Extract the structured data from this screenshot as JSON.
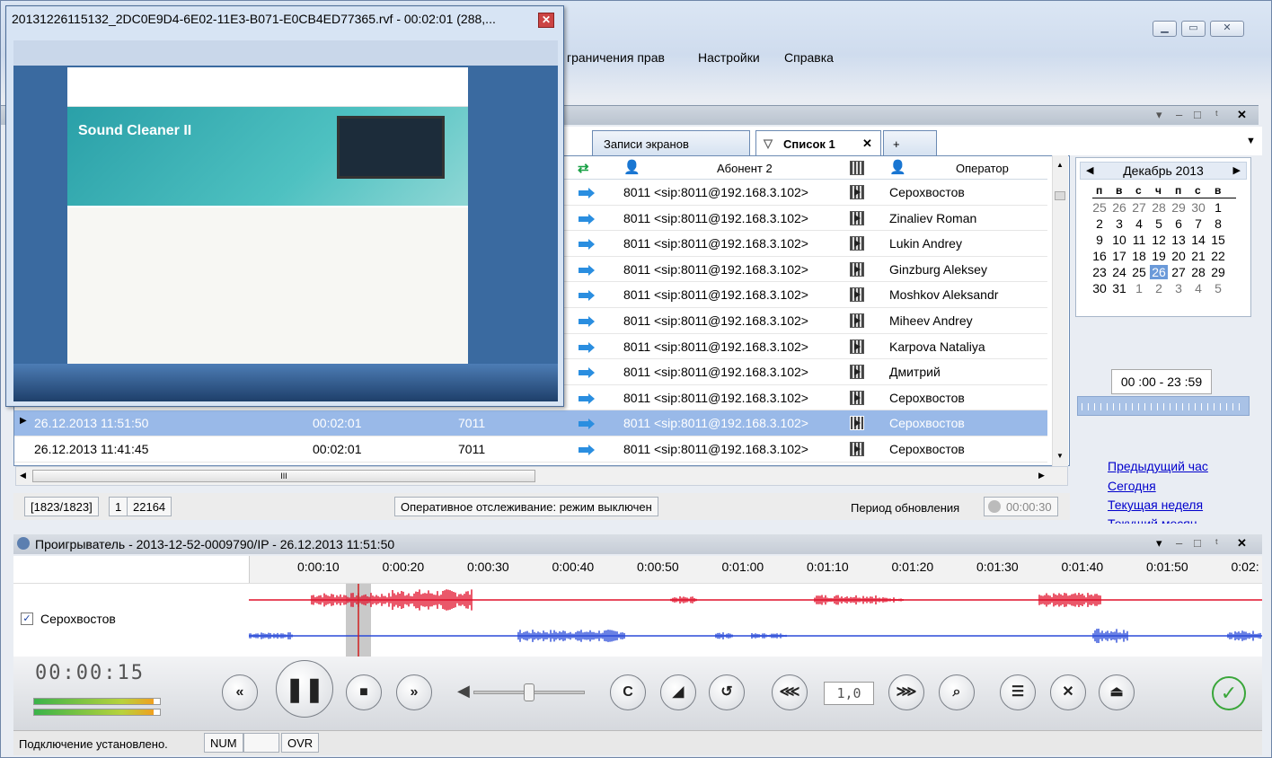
{
  "main_window": {
    "menu": [
      "граничения прав",
      "Настройки",
      "Справка"
    ],
    "dock_controls": [
      "▾",
      "–",
      "□",
      "ᵗ",
      "✕"
    ]
  },
  "tabs": [
    {
      "label": "Записи экранов",
      "active": false
    },
    {
      "label": "Список 1",
      "active": true
    },
    {
      "label": "+",
      "active": false
    }
  ],
  "grid": {
    "columns": [
      "Абонент 2",
      "Оператор"
    ],
    "rows": [
      {
        "datetime": "",
        "duration": "",
        "number": "",
        "abonent2": "8011 <sip:8011@192.168.3.102>",
        "operator": "Серохвостов",
        "selected": false
      },
      {
        "datetime": "",
        "duration": "",
        "number": "",
        "abonent2": "8011 <sip:8011@192.168.3.102>",
        "operator": "Zinaliev Roman",
        "selected": false
      },
      {
        "datetime": "",
        "duration": "",
        "number": "",
        "abonent2": "8011 <sip:8011@192.168.3.102>",
        "operator": "Lukin Andrey",
        "selected": false
      },
      {
        "datetime": "",
        "duration": "",
        "number": "",
        "abonent2": "8011 <sip:8011@192.168.3.102>",
        "operator": "Ginzburg Aleksey",
        "selected": false
      },
      {
        "datetime": "",
        "duration": "",
        "number": "",
        "abonent2": "8011 <sip:8011@192.168.3.102>",
        "operator": "Moshkov Aleksandr",
        "selected": false
      },
      {
        "datetime": "",
        "duration": "",
        "number": "",
        "abonent2": "8011 <sip:8011@192.168.3.102>",
        "operator": "Miheev Andrey",
        "selected": false
      },
      {
        "datetime": "",
        "duration": "",
        "number": "",
        "abonent2": "8011 <sip:8011@192.168.3.102>",
        "operator": "Karpova Nataliya",
        "selected": false
      },
      {
        "datetime": "",
        "duration": "",
        "number": "",
        "abonent2": "8011 <sip:8011@192.168.3.102>",
        "operator": "Дмитрий",
        "selected": false
      },
      {
        "datetime": "",
        "duration": "",
        "number": "",
        "abonent2": "8011 <sip:8011@192.168.3.102>",
        "operator": "Серохвостов",
        "selected": false
      },
      {
        "datetime": "26.12.2013 11:51:50",
        "duration": "00:02:01",
        "number": "7011",
        "abonent2": "8011 <sip:8011@192.168.3.102>",
        "operator": "Серохвостов",
        "selected": true
      },
      {
        "datetime": "26.12.2013 11:41:45",
        "duration": "00:02:01",
        "number": "7011",
        "abonent2": "8011 <sip:8011@192.168.3.102>",
        "operator": "Серохвостов",
        "selected": false
      }
    ]
  },
  "grid_status": {
    "count": "[1823/1823]",
    "page": "1",
    "id": "22164",
    "monitor": "Оперативное отслеживание: режим выключен",
    "refresh_label": "Период обновления",
    "refresh_value": "00:00:30"
  },
  "calendar": {
    "month": "Декабрь 2013",
    "weekdays": [
      "п",
      "в",
      "с",
      "ч",
      "п",
      "с",
      "в"
    ],
    "weeks": [
      [
        "25",
        "26",
        "27",
        "28",
        "29",
        "30",
        "1"
      ],
      [
        "2",
        "3",
        "4",
        "5",
        "6",
        "7",
        "8"
      ],
      [
        "9",
        "10",
        "11",
        "12",
        "13",
        "14",
        "15"
      ],
      [
        "16",
        "17",
        "18",
        "19",
        "20",
        "21",
        "22"
      ],
      [
        "23",
        "24",
        "25",
        "26",
        "27",
        "28",
        "29"
      ],
      [
        "30",
        "31",
        "1",
        "2",
        "3",
        "4",
        "5"
      ]
    ],
    "today": "26",
    "time_range": "00 :00 - 23 :59",
    "links": [
      "Предыдущий час",
      "Сегодня",
      "Текущая неделя",
      "Текущий месяц"
    ]
  },
  "player": {
    "title": "Проигрыватель - 2013-12-52-0009790/IP - 26.12.2013 11:51:50",
    "ticks": [
      "0:00:10",
      "0:00:20",
      "0:00:30",
      "0:00:40",
      "0:00:50",
      "0:01:00",
      "0:01:10",
      "0:01:20",
      "0:01:30",
      "0:01:40",
      "0:01:50",
      "0:02:"
    ],
    "track_name": "Серохвостов",
    "track_checked": true,
    "time": "00:00:15",
    "speed": "1,0",
    "colors": {
      "channel1": "#e0102a",
      "channel2": "#2a4bd8"
    }
  },
  "statusbar": {
    "text": "Подключение установлено.",
    "num": "NUM",
    "ovr": "OVR"
  },
  "overlay": {
    "title": "20131226115132_2DC0E9D4-6E02-11E3-B071-E0CB4ED77365.rvf - 00:02:01 (288,...",
    "screen_heading": "Sound Cleaner II"
  }
}
